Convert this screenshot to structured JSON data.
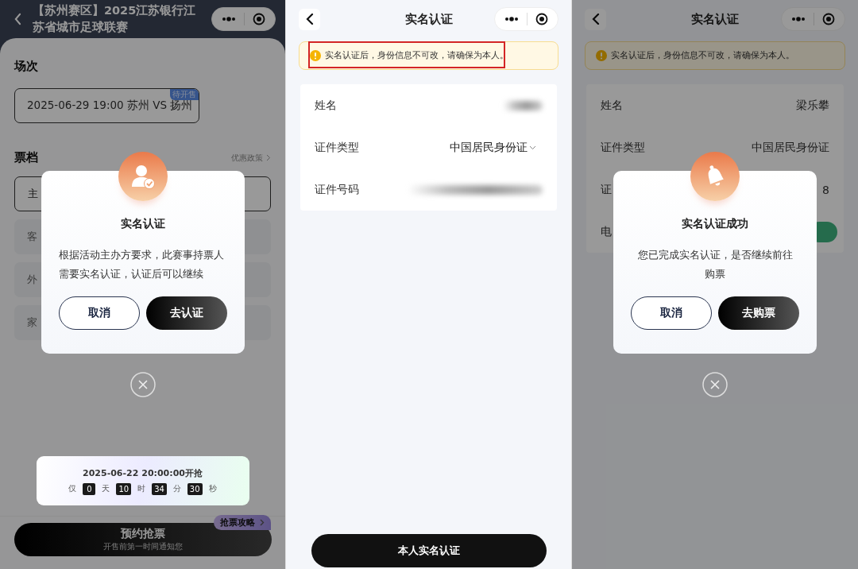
{
  "ticket_page": {
    "title": "【苏州赛区】2025江苏银行江苏省城市足球联赛",
    "session_label": "场次",
    "session": {
      "text": "2025-06-29 19:00 苏州 VS 扬州",
      "badge": "待开售"
    },
    "tier_label": "票档",
    "policy_link": "优惠政策",
    "tiers": [
      {
        "label": "主",
        "selected": true
      },
      {
        "label": "客",
        "selected": false
      },
      {
        "label": "外",
        "selected": false
      },
      {
        "label": "家",
        "selected": false
      }
    ],
    "reserve_button": {
      "label": "预约抢票",
      "sublabel": "开售前第一时间通知您"
    },
    "guide_tag": "抢票攻略"
  },
  "ticket_dialog": {
    "title": "实名认证",
    "message": "根据活动主办方要求，此赛事持票人需要实名认证，认证后可以继续",
    "buttons": [
      "取消",
      "去认证"
    ]
  },
  "countdown": {
    "time": "2025-06-22 20:00:00开抢",
    "prefix": "仅",
    "units": [
      {
        "value": "0",
        "unit": "天"
      },
      {
        "value": "10",
        "unit": "时"
      },
      {
        "value": "34",
        "unit": "分"
      },
      {
        "value": "30",
        "unit": "秒"
      }
    ]
  },
  "verify_page": {
    "title": "实名认证",
    "notice": "实名认证后，身份信息不可改，请确保为本人。",
    "fields": [
      {
        "label": "姓名",
        "kind": "blurred"
      },
      {
        "label": "证件类型",
        "kind": "select",
        "value": "中国居民身份证"
      },
      {
        "label": "证件号码",
        "kind": "blurred"
      }
    ],
    "submit": "本人实名认证"
  },
  "success_page": {
    "title": "实名认证",
    "notice": "实名认证后，身份信息不可改，请确保为本人。",
    "fields": [
      {
        "label": "姓名",
        "kind": "text",
        "value": "梁乐攀"
      },
      {
        "label": "证件类型",
        "kind": "text",
        "value": "中国居民身份证"
      },
      {
        "label": "证",
        "kind": "text",
        "value": "8"
      },
      {
        "label": "电",
        "kind": "button"
      }
    ]
  },
  "success_dialog": {
    "title": "实名认证成功",
    "message": "您已完成实名认证，是否继续前往购票",
    "buttons": [
      "取消",
      "去购票"
    ]
  }
}
